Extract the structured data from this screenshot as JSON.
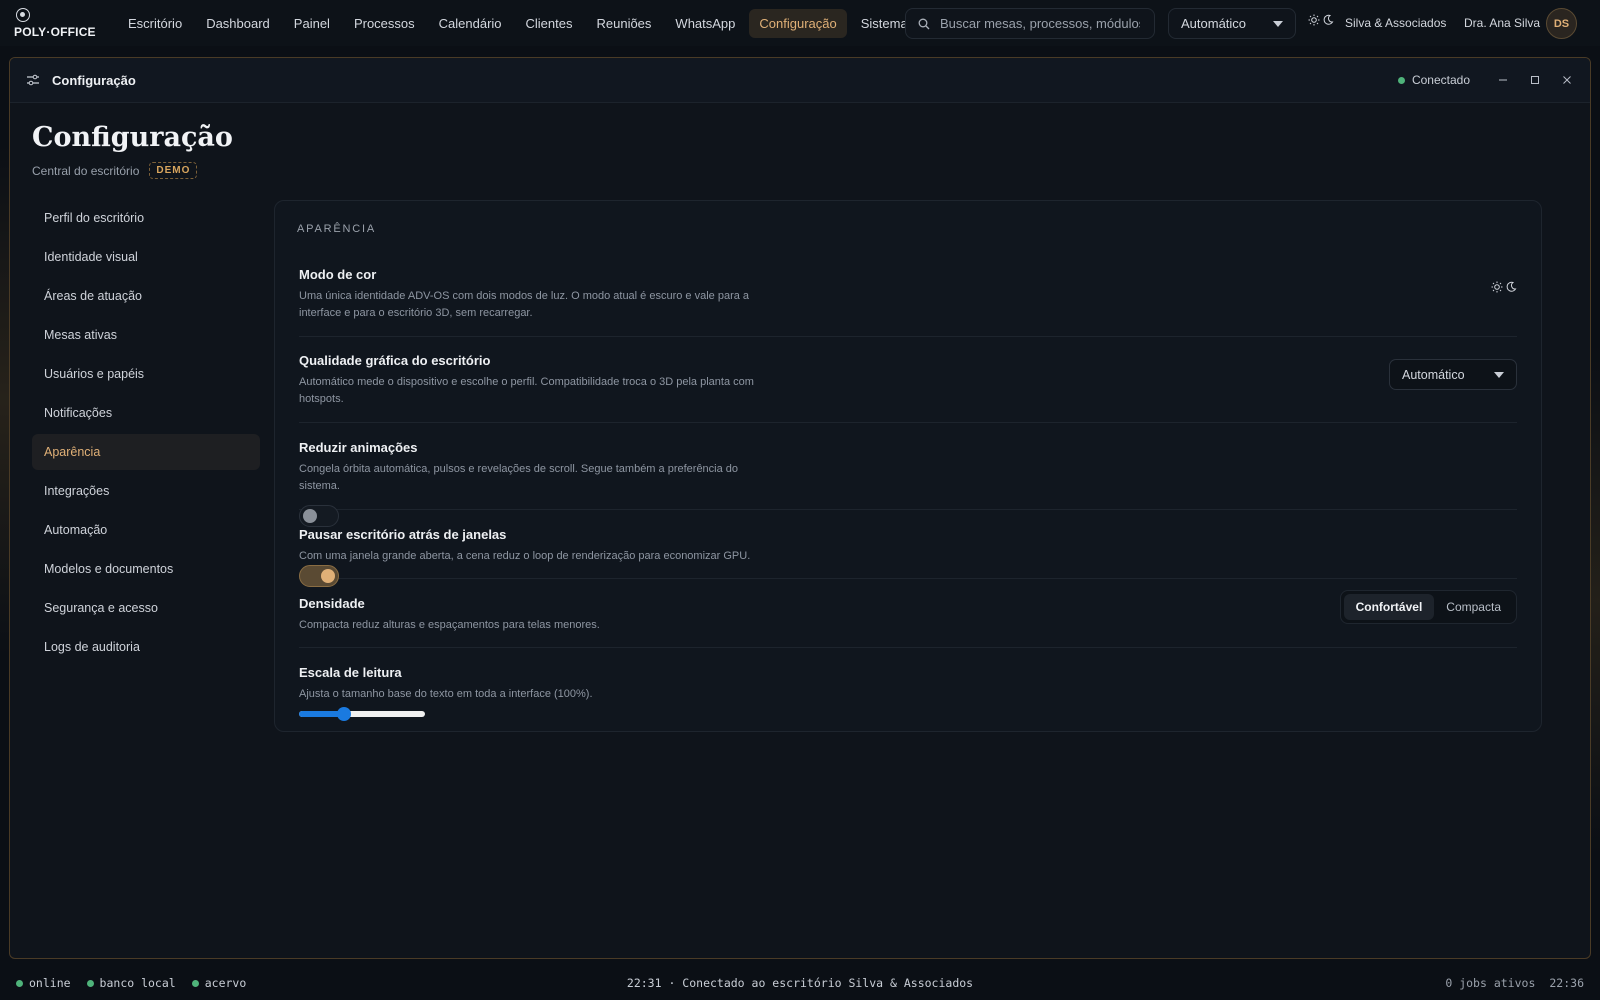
{
  "brand": {
    "name": "POLY·OFFICE",
    "logo": "target-logo"
  },
  "nav": {
    "items": [
      {
        "label": "Escritório"
      },
      {
        "label": "Dashboard"
      },
      {
        "label": "Painel"
      },
      {
        "label": "Processos"
      },
      {
        "label": "Calendário"
      },
      {
        "label": "Clientes"
      },
      {
        "label": "Reuniões"
      },
      {
        "label": "WhatsApp"
      },
      {
        "label": "Configuração",
        "active": true
      },
      {
        "label": "Sistema"
      }
    ]
  },
  "search": {
    "placeholder": "Buscar mesas, processos, módulos"
  },
  "quality_select_top": {
    "value": "Automático"
  },
  "firm": "Silva & Associados",
  "user": {
    "name": "Dra. Ana Silva",
    "initials": "DS"
  },
  "window": {
    "title": "Configuração",
    "status": "Conectado",
    "icon": "sliders-icon"
  },
  "page": {
    "title": "Configuração",
    "subtitle": "Central do escritório",
    "badge": "DEMO"
  },
  "sidebar": {
    "items": [
      {
        "label": "Perfil do escritório"
      },
      {
        "label": "Identidade visual"
      },
      {
        "label": "Áreas de atuação"
      },
      {
        "label": "Mesas ativas"
      },
      {
        "label": "Usuários e papéis"
      },
      {
        "label": "Notificações"
      },
      {
        "label": "Aparência",
        "active": true
      },
      {
        "label": "Integrações"
      },
      {
        "label": "Automação"
      },
      {
        "label": "Modelos e documentos"
      },
      {
        "label": "Segurança e acesso"
      },
      {
        "label": "Logs de auditoria"
      }
    ]
  },
  "appearance": {
    "section_label": "APARÊNCIA",
    "color_mode": {
      "title": "Modo de cor",
      "desc": "Uma única identidade ADV-OS com dois modos de luz. O modo atual é escuro e vale para a interface e para o escritório 3D, sem recarregar."
    },
    "graphics_quality": {
      "title": "Qualidade gráfica do escritório",
      "desc": "Automático mede o dispositivo e escolhe o perfil. Compatibilidade troca o 3D pela planta com hotspots.",
      "value": "Automático"
    },
    "reduce_motion": {
      "title": "Reduzir animações",
      "desc": "Congela órbita automática, pulsos e revelações de scroll. Segue também a preferência do sistema.",
      "on": false
    },
    "pause_office": {
      "title": "Pausar escritório atrás de janelas",
      "desc": "Com uma janela grande aberta, a cena reduz o loop de renderização para economizar GPU.",
      "on": true
    },
    "density": {
      "title": "Densidade",
      "desc": "Compacta reduz alturas e espaçamentos para telas menores.",
      "options": [
        "Confortável",
        "Compacta"
      ],
      "selected": "Confortável"
    },
    "reading_scale": {
      "title": "Escala de leitura",
      "desc": "Ajusta o tamanho base do texto em toda a interface (100%).",
      "level": 0.36
    }
  },
  "statusbar": {
    "left": [
      "online",
      "banco local",
      "acervo"
    ],
    "center": "22:31 · Conectado ao escritório Silva & Associados",
    "jobs": "0 jobs ativos",
    "time": "22:36"
  },
  "colors": {
    "accent": "#e0b077",
    "online": "#4fb37a",
    "slider": "#1a7ae0"
  }
}
